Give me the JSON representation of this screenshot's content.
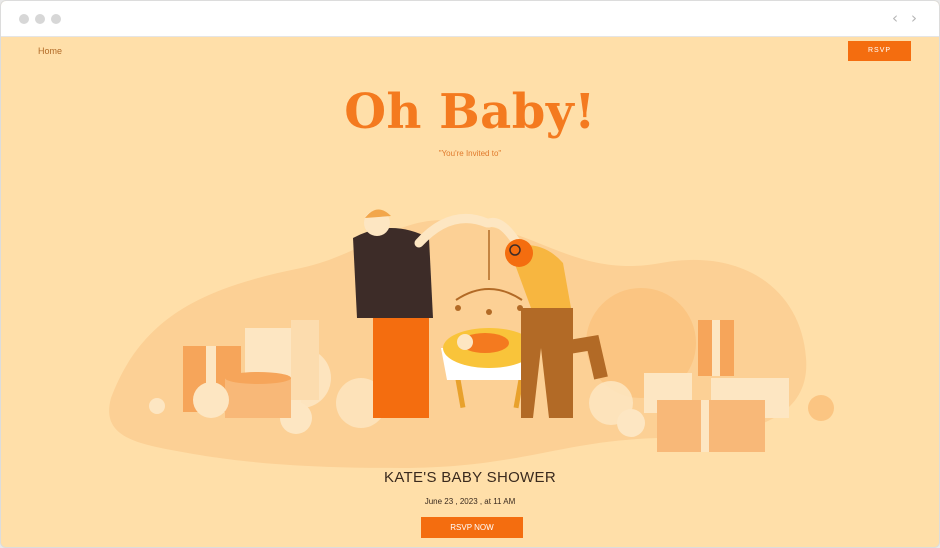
{
  "nav": {
    "home_label": "Home",
    "rsvp_label": "RSVP"
  },
  "hero": {
    "headline": "Oh Baby!",
    "subtitle": "\"You're Invited to\""
  },
  "event": {
    "title": "KATE'S BABY SHOWER",
    "date": "June 23 , 2023 , at 11 AM",
    "rsvp_button": "RSVP NOW"
  },
  "colors": {
    "background": "#ffdfa9",
    "accent": "#f46d0f",
    "headline": "#f47a1f"
  }
}
